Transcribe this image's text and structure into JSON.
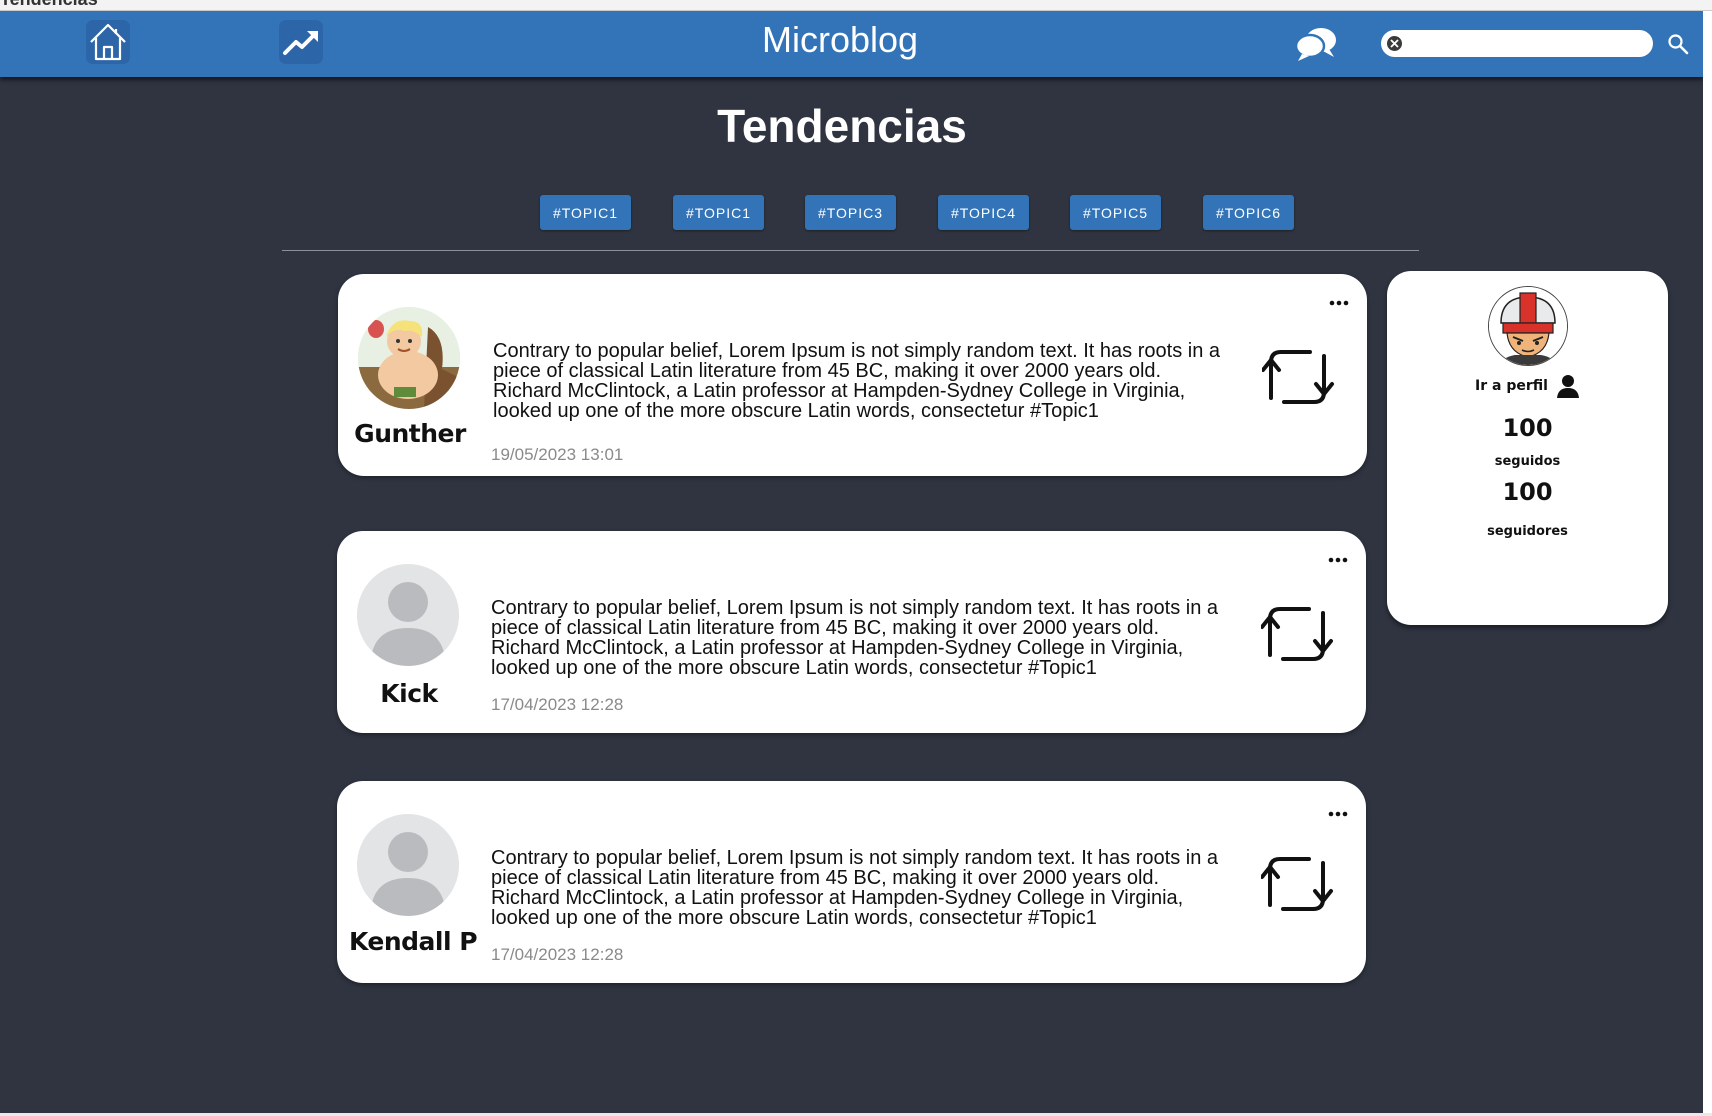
{
  "window": {
    "title": "Tendencias"
  },
  "header": {
    "app_title": "Microblog",
    "search": {
      "value": "",
      "placeholder": ""
    }
  },
  "page": {
    "heading": "Tendencias"
  },
  "topics": [
    "#TOPIC1",
    "#TOPIC1",
    "#TOPIC3",
    "#TOPIC4",
    "#TOPIC5",
    "#TOPIC6"
  ],
  "posts": [
    {
      "author": "Gunther",
      "text": "Contrary to popular belief, Lorem Ipsum is not simply random text. It has roots in a piece of classical Latin literature from 45 BC, making it over 2000 years old. Richard McClintock, a Latin professor at Hampden-Sydney College in Virginia, looked up one of the more obscure Latin words, consectetur #Topic1",
      "date": "19/05/2023 13:01"
    },
    {
      "author": "Kick",
      "text": "Contrary to popular belief, Lorem Ipsum is not simply random text. It has roots in a piece of classical Latin literature from 45 BC, making it over 2000 years old. Richard McClintock, a Latin professor at Hampden-Sydney College in Virginia, looked up one of the more obscure Latin words, consectetur #Topic1",
      "date": "17/04/2023 12:28"
    },
    {
      "author": "Kendall  P",
      "text": "Contrary to popular belief, Lorem Ipsum is not simply random text. It has roots in a piece of classical Latin literature from 45 BC, making it over 2000 years old. Richard McClintock, a Latin professor at Hampden-Sydney College in Virginia, looked up one of the more obscure Latin words, consectetur #Topic1",
      "date": "17/04/2023 12:28"
    }
  ],
  "profile": {
    "link_label": "Ir a perfil",
    "following_count": "100",
    "following_label": "seguidos",
    "followers_count": "100",
    "followers_label": "seguidores"
  },
  "colors": {
    "header": "#3374b9",
    "background": "#2f3440",
    "card": "#ffffff",
    "date_text": "#8a8a8a"
  },
  "icons": {
    "home": "home-icon",
    "trending": "trending-up-icon",
    "chat": "chat-bubbles-icon",
    "search": "search-icon",
    "clear": "clear-icon",
    "repost": "repost-icon",
    "more": "more-icon",
    "user": "user-icon"
  }
}
